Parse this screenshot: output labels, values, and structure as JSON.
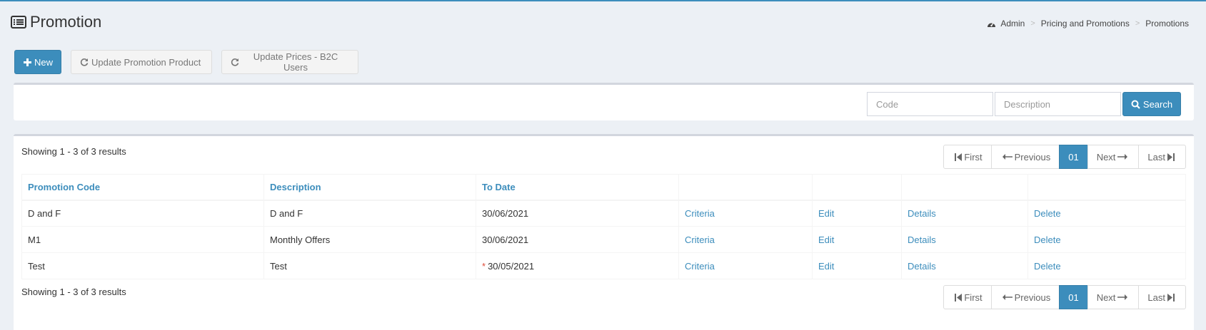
{
  "page": {
    "title": "Promotion",
    "title_icon": "list-alt-icon"
  },
  "breadcrumb": {
    "icon": "dashboard-icon",
    "items": [
      "Admin",
      "Pricing and Promotions",
      "Promotions"
    ],
    "separator": ">"
  },
  "toolbar": {
    "new_label": "New",
    "update_product_label": "Update Promotion Product",
    "update_prices_label": "Update Prices - B2C Users"
  },
  "search": {
    "code_placeholder": "Code",
    "code_value": "",
    "description_placeholder": "Description",
    "description_value": "",
    "button_label": "Search"
  },
  "results": {
    "showing_text": "Showing 1 - 3 of 3 results",
    "pager": {
      "first": "First",
      "previous": "Previous",
      "current": "01",
      "next": "Next",
      "last": "Last"
    },
    "columns": [
      "Promotion Code",
      "Description",
      "To Date",
      "",
      "",
      "",
      ""
    ],
    "rows": [
      {
        "code": "D and F",
        "description": "D and F",
        "to_date": "30/06/2021",
        "expired": false,
        "criteria": "Criteria",
        "edit": "Edit",
        "details": "Details",
        "delete": "Delete"
      },
      {
        "code": "M1",
        "description": "Monthly Offers",
        "to_date": "30/06/2021",
        "expired": false,
        "criteria": "Criteria",
        "edit": "Edit",
        "details": "Details",
        "delete": "Delete"
      },
      {
        "code": "Test",
        "description": "Test",
        "to_date": "30/05/2021",
        "expired": true,
        "expired_marker": "*",
        "criteria": "Criteria",
        "edit": "Edit",
        "details": "Details",
        "delete": "Delete"
      }
    ]
  },
  "colors": {
    "primary": "#3c8dbc",
    "background": "#ecf0f5",
    "danger": "#dd4b39"
  }
}
